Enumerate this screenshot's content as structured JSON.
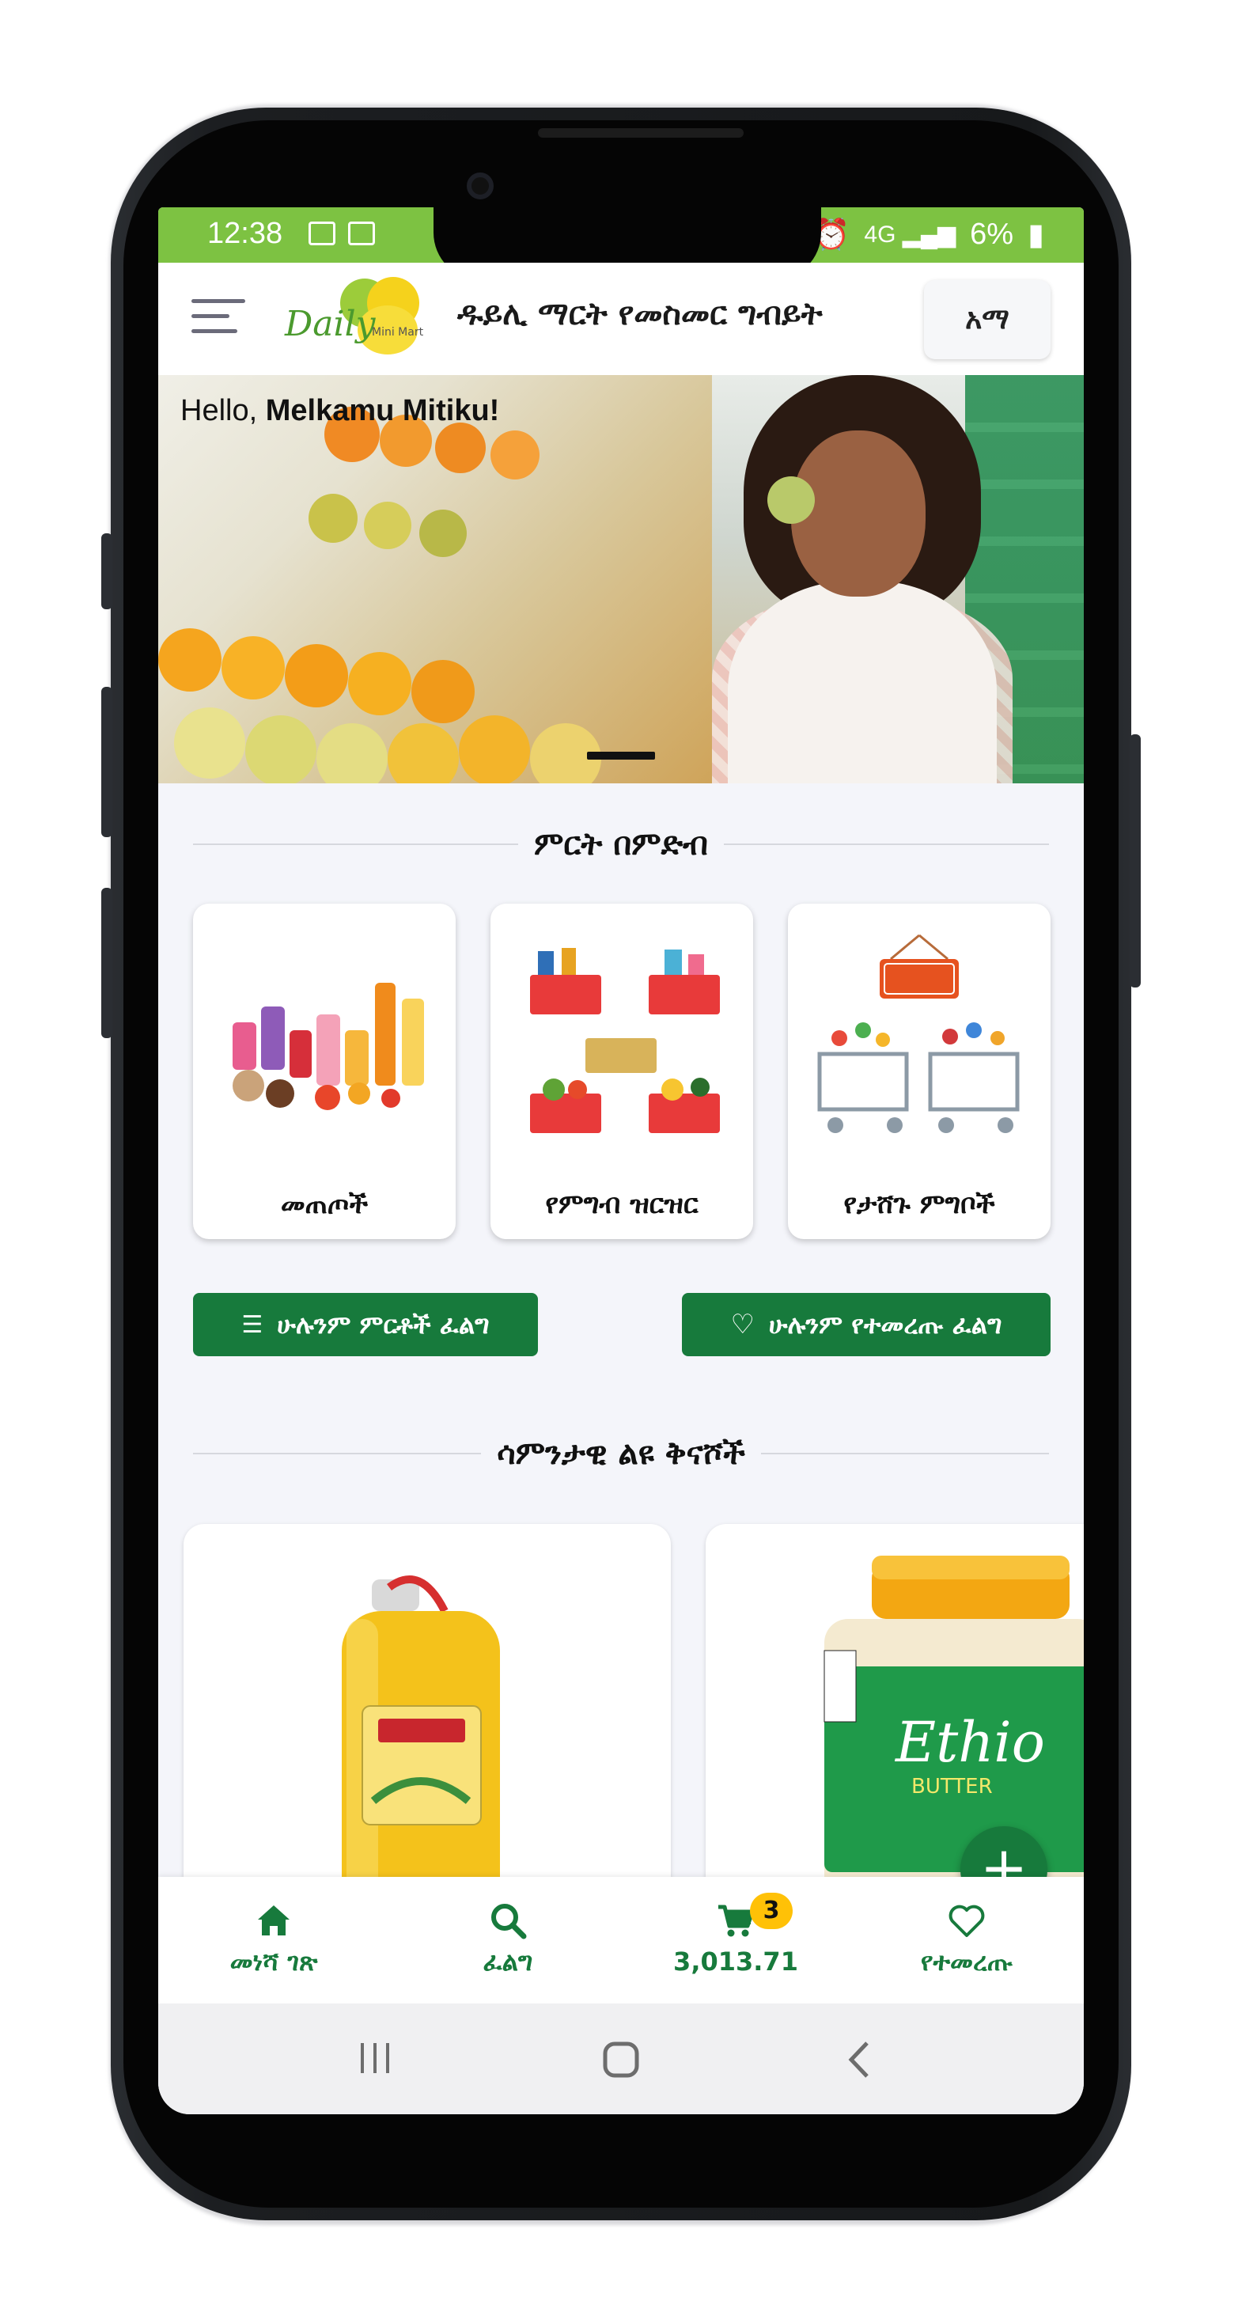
{
  "status": {
    "time": "12:38",
    "battery": "6%"
  },
  "header": {
    "title": "ዱይሊ ማርት የመስመር ግብይት",
    "lang_label": "አማ"
  },
  "banner": {
    "greeting_prefix": "Hello,",
    "greeting_name": "Melkamu Mitiku!"
  },
  "categories_section": {
    "title": "ምርት በምድብ"
  },
  "categories": [
    {
      "label": "መጠጦች"
    },
    {
      "label": "የምግብ ዝርዝር"
    },
    {
      "label": "የታሸጉ ምግቦች"
    }
  ],
  "buttons": {
    "all_products": "ሁሉንም ምርቶች ፈልግ",
    "all_favorites": "ሁሉንም የተመረጡ ፈልግ"
  },
  "specials_section": {
    "title": "ሳምንታዊ ልዩ ቅናሾች"
  },
  "bottom_nav": {
    "home": "መነሻ ገጽ",
    "search": "ፈልግ",
    "cart_total": "3,013.71",
    "cart_count": "3",
    "favorites": "የተመረጡ"
  },
  "colors": {
    "primary": "#177a3c",
    "status_bar": "#7dc242",
    "badge": "#ffc107"
  }
}
